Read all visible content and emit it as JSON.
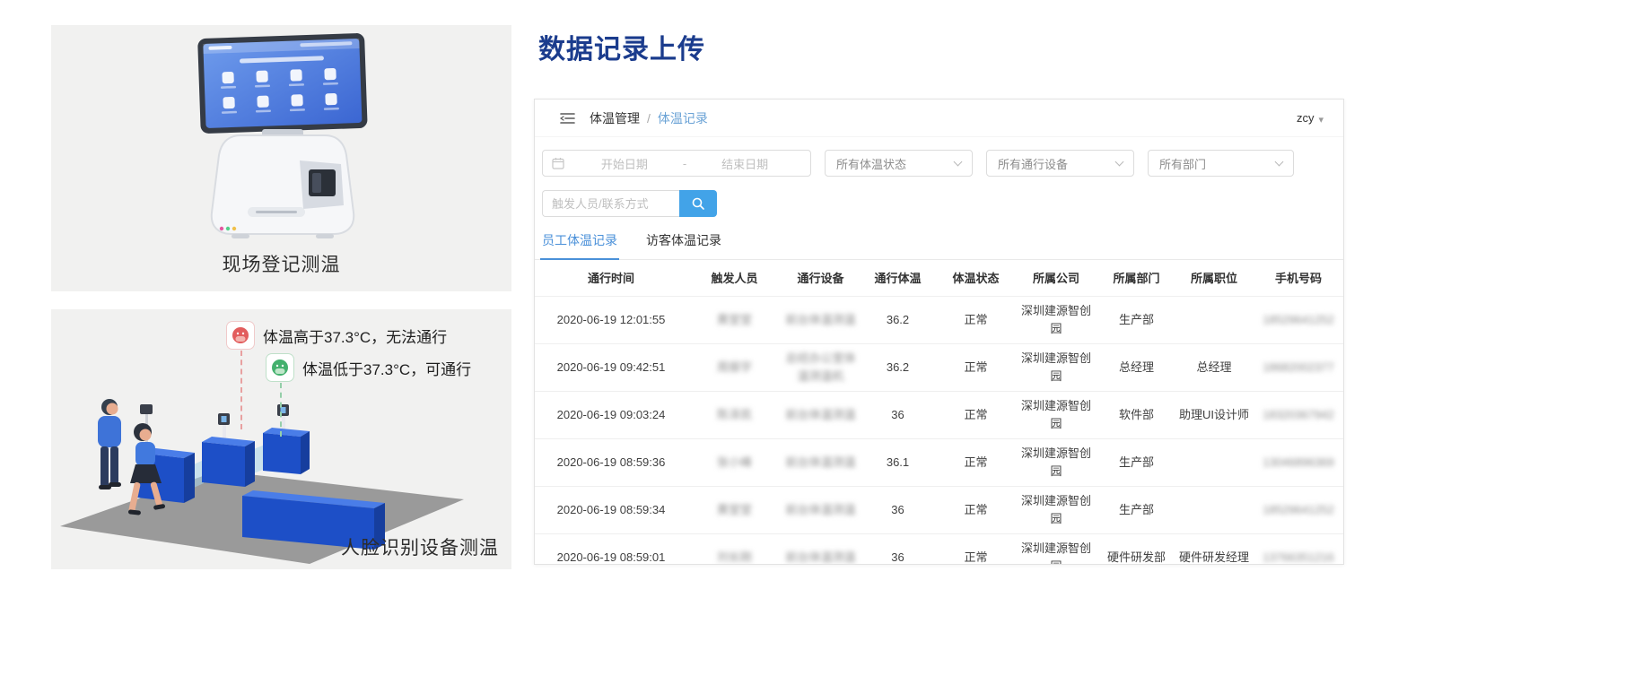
{
  "colors": {
    "title_blue": "#1b3c8d",
    "accent_blue": "#4a90d9",
    "breadcrumb_blue": "#6ba3d6",
    "search_button_blue": "#42a3e8",
    "panel_bg": "#f1f1f0",
    "alert_red": "#e25d5d",
    "ok_green": "#43b06d"
  },
  "left": {
    "panel1": {
      "caption": "现场登记测温"
    },
    "panel2": {
      "annotation_high": "体温高于37.3°C，无法通行",
      "annotation_low": "体温低于37.3°C，可通行",
      "caption": "人脸识别设备测温"
    }
  },
  "main": {
    "title": "数据记录上传",
    "header": {
      "breadcrumb_root": "体温管理",
      "breadcrumb_separator": "/",
      "breadcrumb_current": "体温记录",
      "user": "zcy"
    },
    "filters": {
      "start_date_placeholder": "开始日期",
      "date_separator": "-",
      "end_date_placeholder": "结束日期",
      "status_select_value": "所有体温状态",
      "device_select_value": "所有通行设备",
      "department_select_value": "所有部门",
      "person_input_placeholder": "触发人员/联系方式"
    },
    "tabs": [
      {
        "label": "员工体温记录",
        "active": true
      },
      {
        "label": "访客体温记录",
        "active": false
      }
    ],
    "table": {
      "headers": [
        "通行时间",
        "触发人员",
        "通行设备",
        "通行体温",
        "体温状态",
        "所属公司",
        "所属部门",
        "所属职位",
        "手机号码"
      ],
      "redacted_columns": [
        1,
        2,
        8
      ],
      "rows": [
        [
          "2020-06-19 12:01:55",
          "黄堂堂",
          "前台体温测温",
          "36.2",
          "正常",
          "深圳建源智创园",
          "生产部",
          "",
          "18529641252"
        ],
        [
          "2020-06-19 09:42:51",
          "周振宇",
          "总经办公室体温测温机",
          "36.2",
          "正常",
          "深圳建源智创园",
          "总经理",
          "总经理",
          "18682002377"
        ],
        [
          "2020-06-19 09:03:24",
          "陈泽凯",
          "前台体温测温",
          "36",
          "正常",
          "深圳建源智创园",
          "软件部",
          "助理UI设计师",
          "18320367942"
        ],
        [
          "2020-06-19 08:59:36",
          "张小峰",
          "前台体温测温",
          "36.1",
          "正常",
          "深圳建源智创园",
          "生产部",
          "",
          "13046896369"
        ],
        [
          "2020-06-19 08:59:34",
          "黄堂堂",
          "前台体温测温",
          "36",
          "正常",
          "深圳建源智创园",
          "生产部",
          "",
          "18529641252"
        ],
        [
          "2020-06-19 08:59:01",
          "刘长刚",
          "前台体温测温",
          "36",
          "正常",
          "深圳建源智创园",
          "硬件研发部",
          "硬件研发经理",
          "13766351216"
        ]
      ]
    }
  }
}
